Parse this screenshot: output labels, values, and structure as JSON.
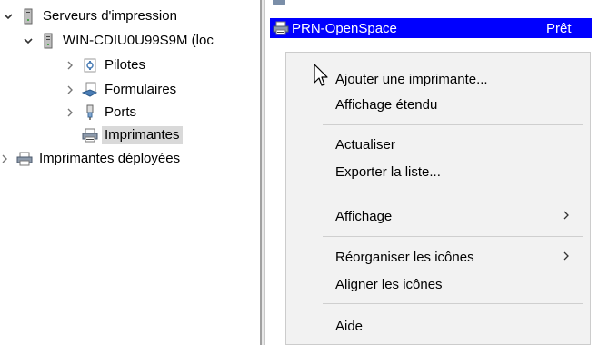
{
  "tree": {
    "items": [
      {
        "label": "Serveurs d'impression",
        "chevron": "expanded",
        "icon": "server-icon"
      },
      {
        "label": "WIN-CDIU0U99S9M (loc",
        "chevron": "expanded",
        "icon": "server-icon"
      },
      {
        "label": "Pilotes",
        "chevron": "collapsed",
        "icon": "drivers-icon"
      },
      {
        "label": "Formulaires",
        "chevron": "collapsed",
        "icon": "forms-icon"
      },
      {
        "label": "Ports",
        "chevron": "collapsed",
        "icon": "port-icon"
      },
      {
        "label": "Imprimantes",
        "chevron": "none",
        "icon": "printer-icon",
        "selected": true
      },
      {
        "label": "Imprimantes déployées",
        "chevron": "collapsed",
        "icon": "printer-icon"
      }
    ]
  },
  "list": {
    "selected_row": {
      "name": "PRN-OpenSpace",
      "status": "Prêt"
    }
  },
  "context_menu": {
    "items": [
      {
        "label": "Ajouter une imprimante...",
        "submenu": false
      },
      {
        "label": "Affichage étendu",
        "submenu": false
      },
      {
        "label": "Actualiser",
        "submenu": false
      },
      {
        "label": "Exporter la liste...",
        "submenu": false
      },
      {
        "label": "Affichage",
        "submenu": true
      },
      {
        "label": "Réorganiser les icônes",
        "submenu": true
      },
      {
        "label": "Aligner les icônes",
        "submenu": false
      },
      {
        "label": "Aide",
        "submenu": false
      }
    ]
  },
  "colors": {
    "selection": "#0000ff",
    "tree_selection": "#d9d9d9",
    "menu_bg": "#f2f2f2"
  }
}
